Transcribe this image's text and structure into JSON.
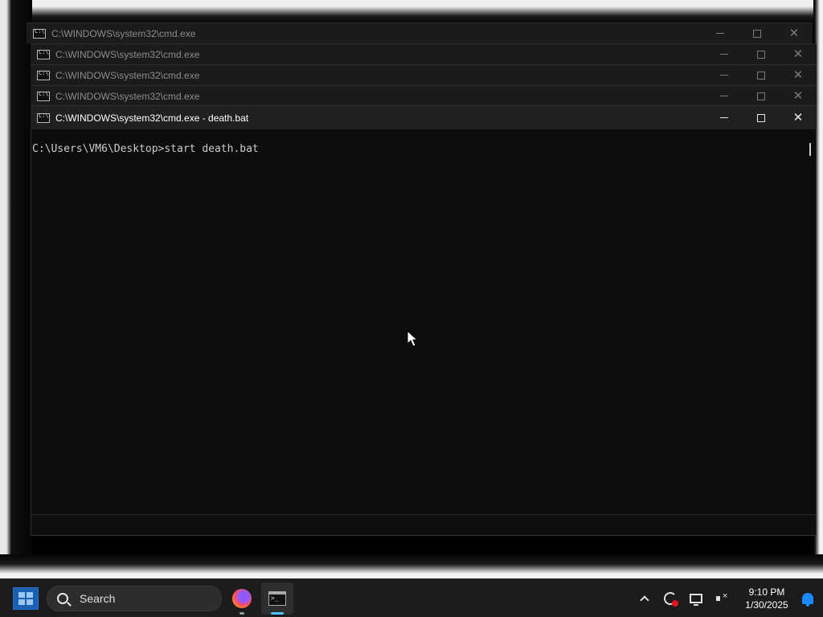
{
  "windows": [
    {
      "title": "C:\\WINDOWS\\system32\\cmd.exe",
      "active": false
    },
    {
      "title": "C:\\WINDOWS\\system32\\cmd.exe",
      "active": false
    },
    {
      "title": "C:\\WINDOWS\\system32\\cmd.exe",
      "active": false
    },
    {
      "title": "C:\\WINDOWS\\system32\\cmd.exe",
      "active": false
    },
    {
      "title": "C:\\WINDOWS\\system32\\cmd.exe - death.bat",
      "active": true
    }
  ],
  "console": {
    "text": "C:\\Users\\VM6\\Desktop>start death.bat"
  },
  "taskbar": {
    "search_label": "Search",
    "apps": [
      {
        "name": "firefox-icon"
      },
      {
        "name": "terminal-icon"
      }
    ],
    "clock_time": "9:10 PM",
    "clock_date": "1/30/2025"
  },
  "colors": {
    "accent": "#1a8cff",
    "start": "#1b5fb5",
    "console_bg": "#0c0c0c",
    "console_text": "#cccccc"
  }
}
